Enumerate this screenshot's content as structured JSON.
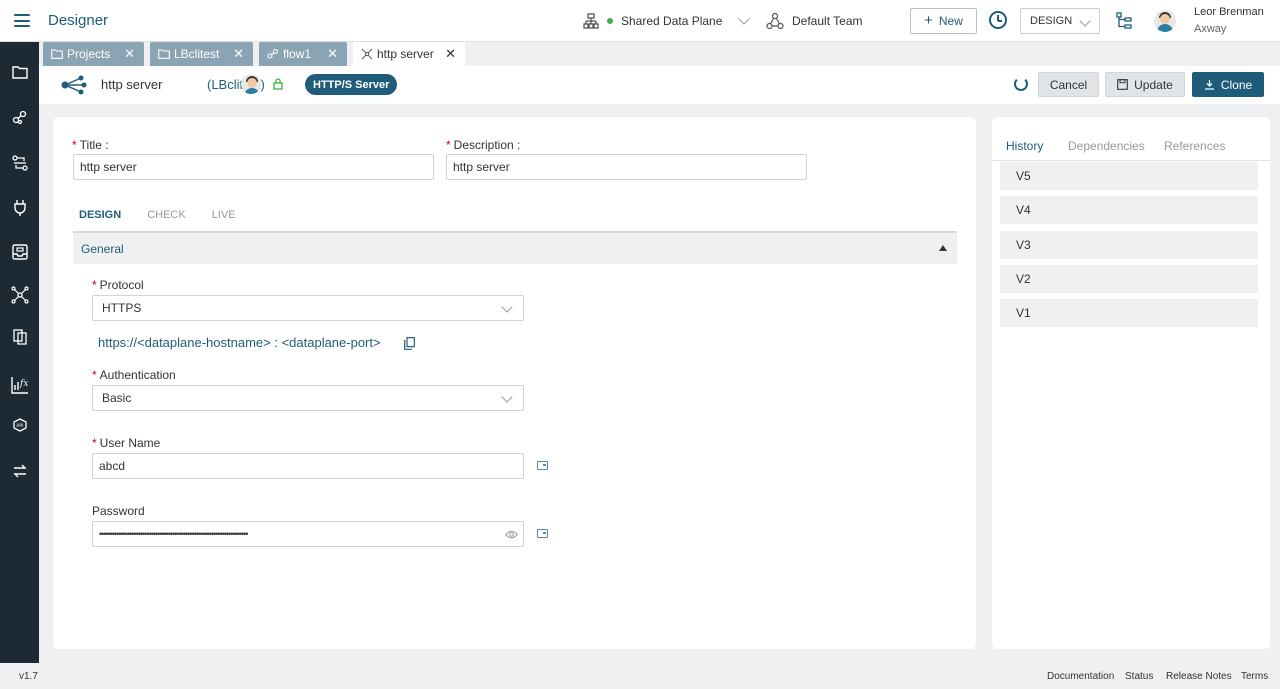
{
  "app": {
    "title": "Designer"
  },
  "topbar": {
    "data_plane": "Shared Data Plane",
    "team": "Default Team",
    "new_label": "New",
    "mode": "DESIGN",
    "user_name": "Leor Brenman",
    "user_org": "Axway"
  },
  "tabs": [
    {
      "label": "Projects",
      "icon": "folder-icon"
    },
    {
      "label": "LBclitest",
      "icon": "folder-icon"
    },
    {
      "label": "flow1",
      "icon": "flow-icon"
    },
    {
      "label": "http server",
      "icon": "connector-icon"
    }
  ],
  "object": {
    "title": "http server",
    "project": "(LBclitest)",
    "type": "HTTP/S Server"
  },
  "actions": {
    "cancel": "Cancel",
    "update": "Update",
    "clone": "Clone"
  },
  "form": {
    "title_label": "Title",
    "title_value": "http server",
    "description_label": "Description",
    "description_value": "http server",
    "subtabs": [
      "DESIGN",
      "CHECK",
      "LIVE"
    ],
    "section": "General",
    "protocol_label": "Protocol",
    "protocol_value": "HTTPS",
    "url": "https://<dataplane-hostname> : <dataplane-port>",
    "auth_label": "Authentication",
    "auth_value": "Basic",
    "username_label": "User Name",
    "username_value": "abcd",
    "password_label": "Password",
    "password_value": "•••••••••••••••••••••••••••••••••••••••••••••••••••••••••••••••••••••"
  },
  "history": {
    "tabs": [
      "History",
      "Dependencies",
      "References"
    ],
    "versions": [
      "V5",
      "V4",
      "V3",
      "V2",
      "V1"
    ]
  },
  "footer": {
    "version": "v1.7",
    "links": [
      "Documentation",
      "Status",
      "Release Notes",
      "Terms"
    ]
  },
  "colors": {
    "brand": "#1f5c7a",
    "rail": "#1e2a33",
    "tab_inactive": "#8ba4b3",
    "required": "#d0021b"
  }
}
